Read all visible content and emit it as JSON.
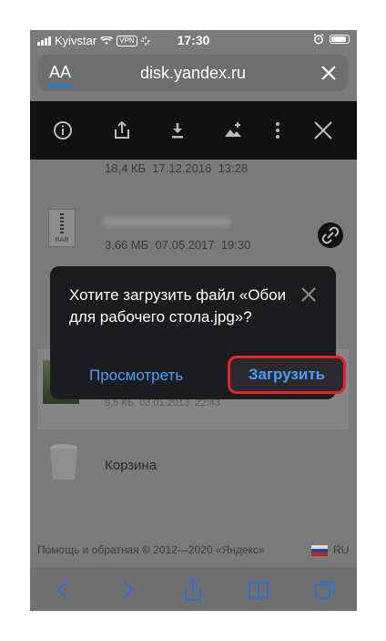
{
  "status_bar": {
    "carrier": "Kyivstar",
    "vpn": "VPN",
    "time": "17:30"
  },
  "address_bar": {
    "text_size_label": "AA",
    "url": "disk.yandex.ru"
  },
  "file_list": [
    {
      "size": "18,4 КБ",
      "date": "17.12.2016",
      "time": "13:28"
    },
    {
      "type_label": "RAR",
      "size": "3,66 МБ",
      "date": "07.05.2017",
      "time": "19:30"
    },
    {
      "size": "9,5 КБ",
      "date": "03.01.2013",
      "time": "22:43"
    }
  ],
  "trash_label": "Корзина",
  "footer": {
    "help_text": "Помощь и обратная",
    "copyright": "© 2012—2020 «Яндекс»",
    "language": "RU"
  },
  "dialog": {
    "message": "Хотите загрузить файл «Обои для рабочего стола.jpg»?",
    "view_label": "Просмотреть",
    "download_label": "Загрузить"
  },
  "colors": {
    "accent": "#4a9eff",
    "highlight": "#e2252f",
    "dialog_bg": "#1c1c1e",
    "toolbar_bg": "#111111"
  }
}
